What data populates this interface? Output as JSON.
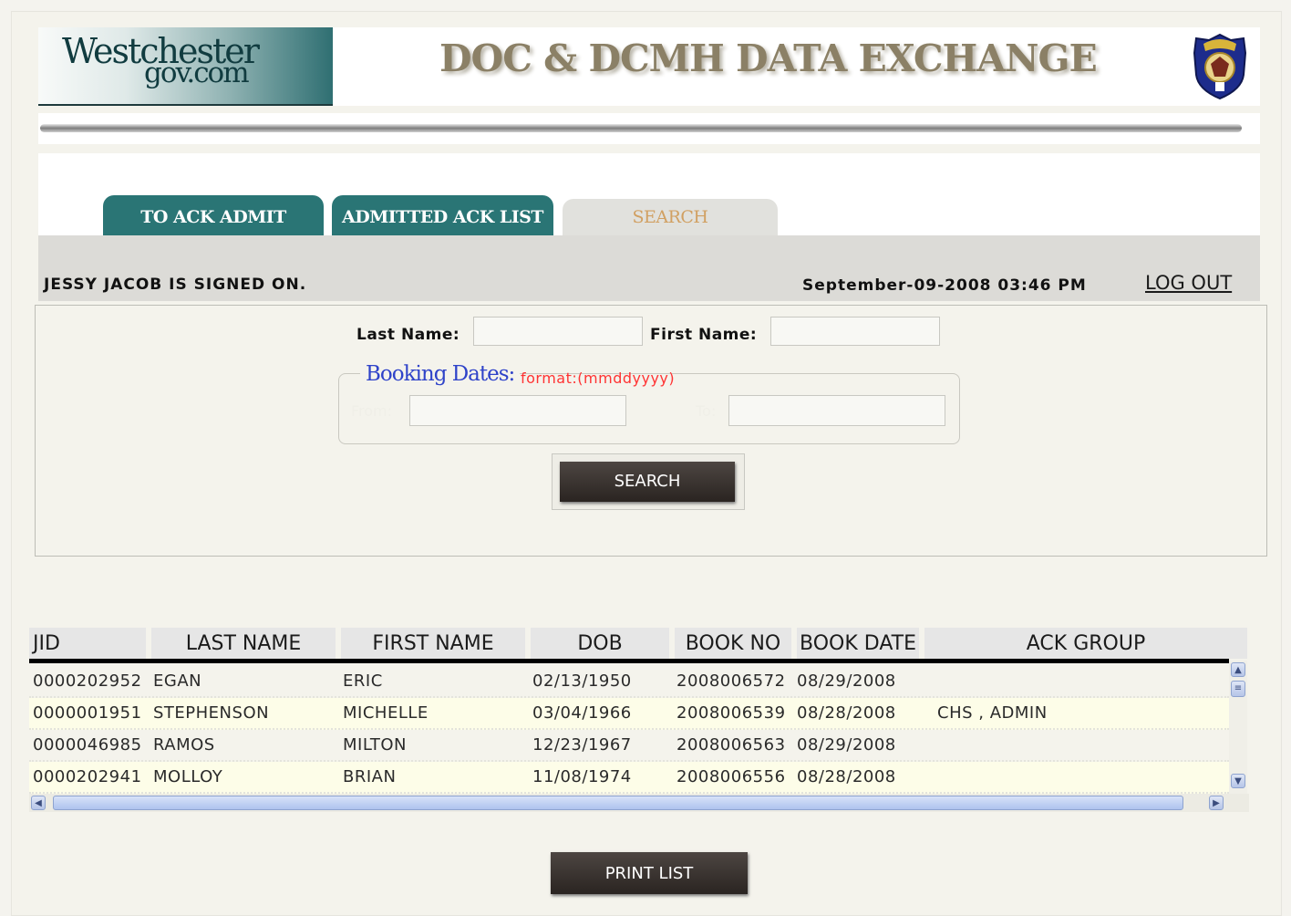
{
  "header": {
    "logo_line1": "Westchester",
    "logo_line2": "gov.com",
    "title": "DOC & DCMH DATA EXCHANGE"
  },
  "tabs": [
    {
      "label": "TO ACK ADMIT",
      "active": false
    },
    {
      "label": "ADMITTED ACK LIST",
      "active": false
    },
    {
      "label": "SEARCH",
      "active": true
    }
  ],
  "status": {
    "signed_on": "JESSY JACOB IS SIGNED ON.",
    "datetime": "September-09-2008 03:46 PM",
    "logout": "LOG OUT"
  },
  "search_form": {
    "last_name_label": "Last Name:",
    "last_name_value": "",
    "first_name_label": "First Name:",
    "first_name_value": "",
    "booking_legend": "Booking Dates:",
    "format_hint": "format:(mmddyyyy)",
    "from_label": "From:",
    "from_value": "",
    "to_label": "To:",
    "to_value": "",
    "search_button": "SEARCH"
  },
  "results": {
    "columns": [
      "JID",
      "LAST NAME",
      "FIRST NAME",
      "DOB",
      "BOOK NO",
      "BOOK DATE",
      "ACK GROUP"
    ],
    "rows": [
      [
        "0000202952",
        "EGAN",
        "ERIC",
        "02/13/1950",
        "2008006572",
        "08/29/2008",
        ""
      ],
      [
        "0000001951",
        "STEPHENSON",
        "MICHELLE",
        "03/04/1966",
        "2008006539",
        "08/28/2008",
        "CHS , ADMIN"
      ],
      [
        "0000046985",
        "RAMOS",
        "MILTON",
        "12/23/1967",
        "2008006563",
        "08/29/2008",
        ""
      ],
      [
        "0000202941",
        "MOLLOY",
        "BRIAN",
        "11/08/1974",
        "2008006556",
        "08/28/2008",
        ""
      ]
    ]
  },
  "print_button": "PRINT LIST",
  "colors": {
    "tab_teal": "#2a7575",
    "button_dark": "#3a3330",
    "legend_blue": "#2f43c9",
    "format_red": "#ff3333"
  }
}
